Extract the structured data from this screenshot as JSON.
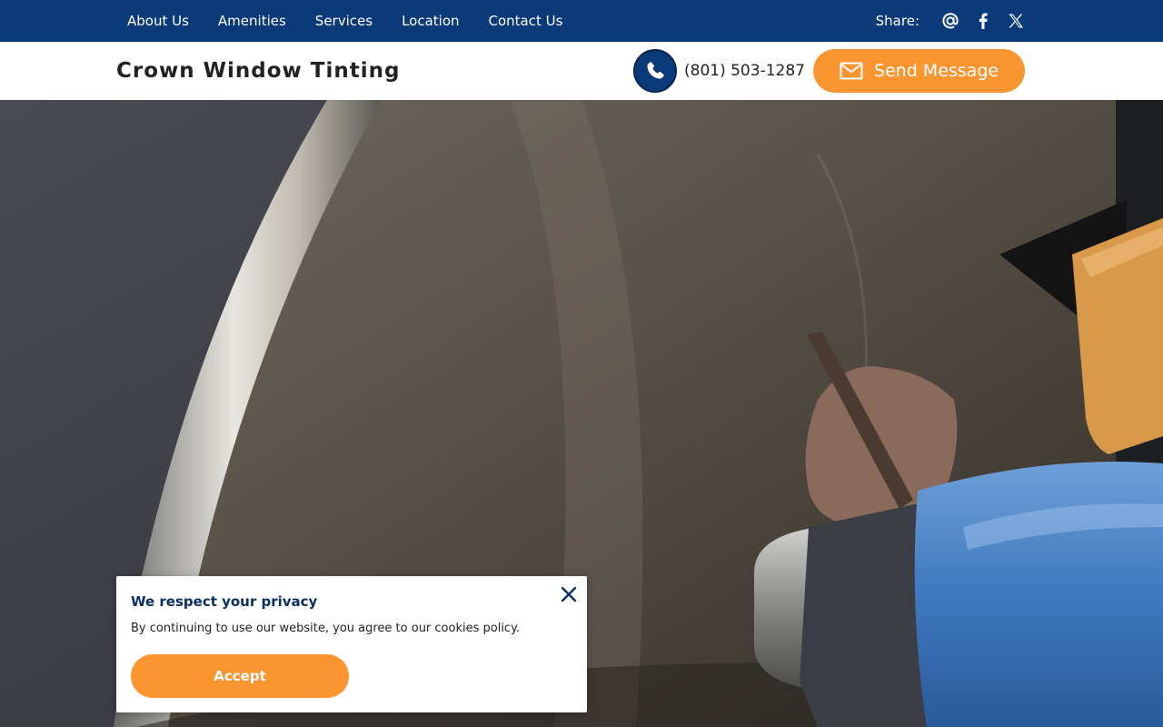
{
  "nav": {
    "links": [
      "About Us",
      "Amenities",
      "Services",
      "Location",
      "Contact Us"
    ],
    "share_label": "Share:",
    "share_icons": [
      "at-icon",
      "facebook-icon",
      "x-icon"
    ]
  },
  "header": {
    "brand": "Crown Window Tinting",
    "phone": "(801) 503-1287",
    "send_label": "Send Message"
  },
  "privacy": {
    "title": "We respect your privacy",
    "text": "By continuing to use our website, you agree to our cookies policy.",
    "accept_label": "Accept"
  },
  "colors": {
    "nav_bg": "#0a3a7a",
    "accent": "#fb9530",
    "title_blue": "#0a2f63"
  }
}
